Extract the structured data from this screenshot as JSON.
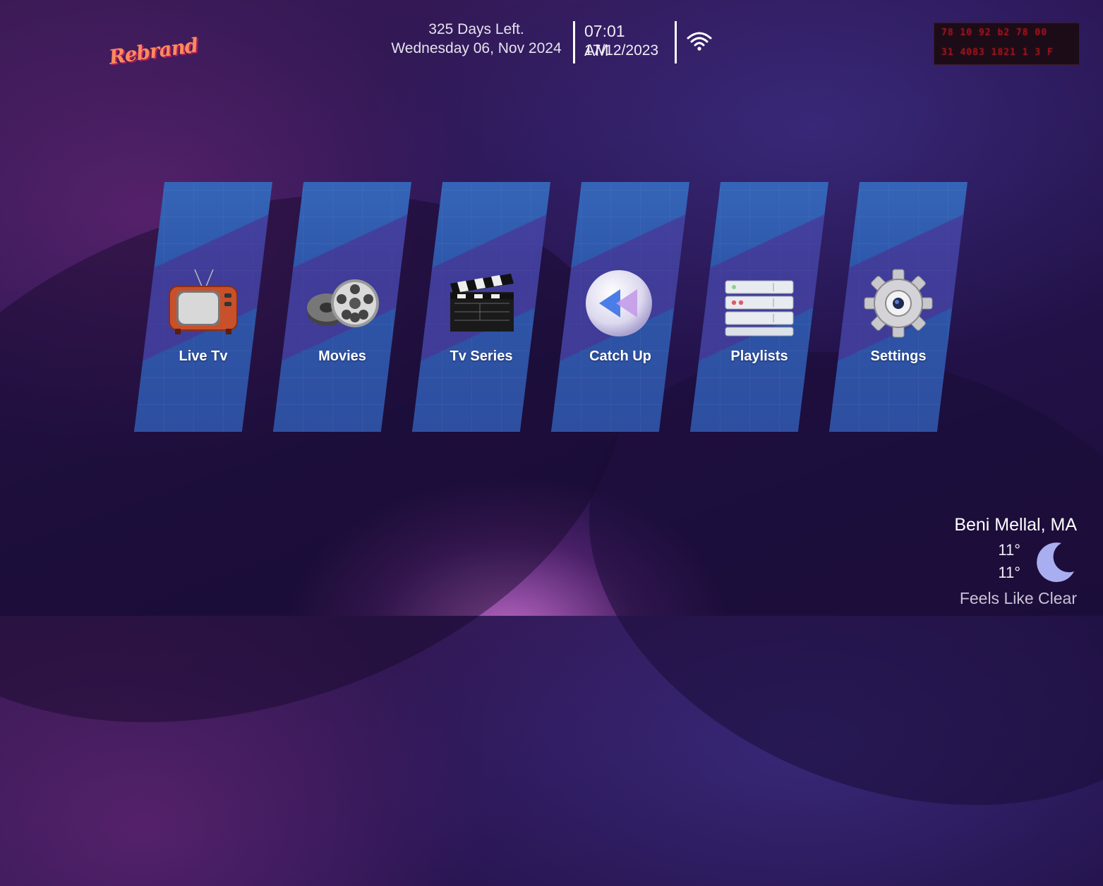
{
  "header": {
    "logo_text": "Rebrand",
    "days_left": "325 Days Left.",
    "expiry_date": "Wednesday 06, Nov 2024",
    "time": "07:01 AM",
    "date": "17/12/2023",
    "device_line1": "78 10 92 b2 78 00",
    "device_line2": "31 4083 1821 1 3 F"
  },
  "menu": {
    "items": [
      {
        "label": "Live Tv",
        "icon": "tv-icon"
      },
      {
        "label": "Movies",
        "icon": "film-reels-icon"
      },
      {
        "label": "Tv Series",
        "icon": "clapperboard-icon"
      },
      {
        "label": "Catch Up",
        "icon": "rewind-icon"
      },
      {
        "label": "Playlists",
        "icon": "server-stack-icon"
      },
      {
        "label": "Settings",
        "icon": "gear-icon"
      }
    ]
  },
  "weather": {
    "city": "Beni Mellal, MA",
    "temp_high": "11°",
    "temp_low": "11°",
    "condition": "Feels Like Clear",
    "icon": "moon-icon"
  },
  "colors": {
    "tile_blue": "#3565b8",
    "background": "#2a1654",
    "device_text": "#b0131a"
  }
}
